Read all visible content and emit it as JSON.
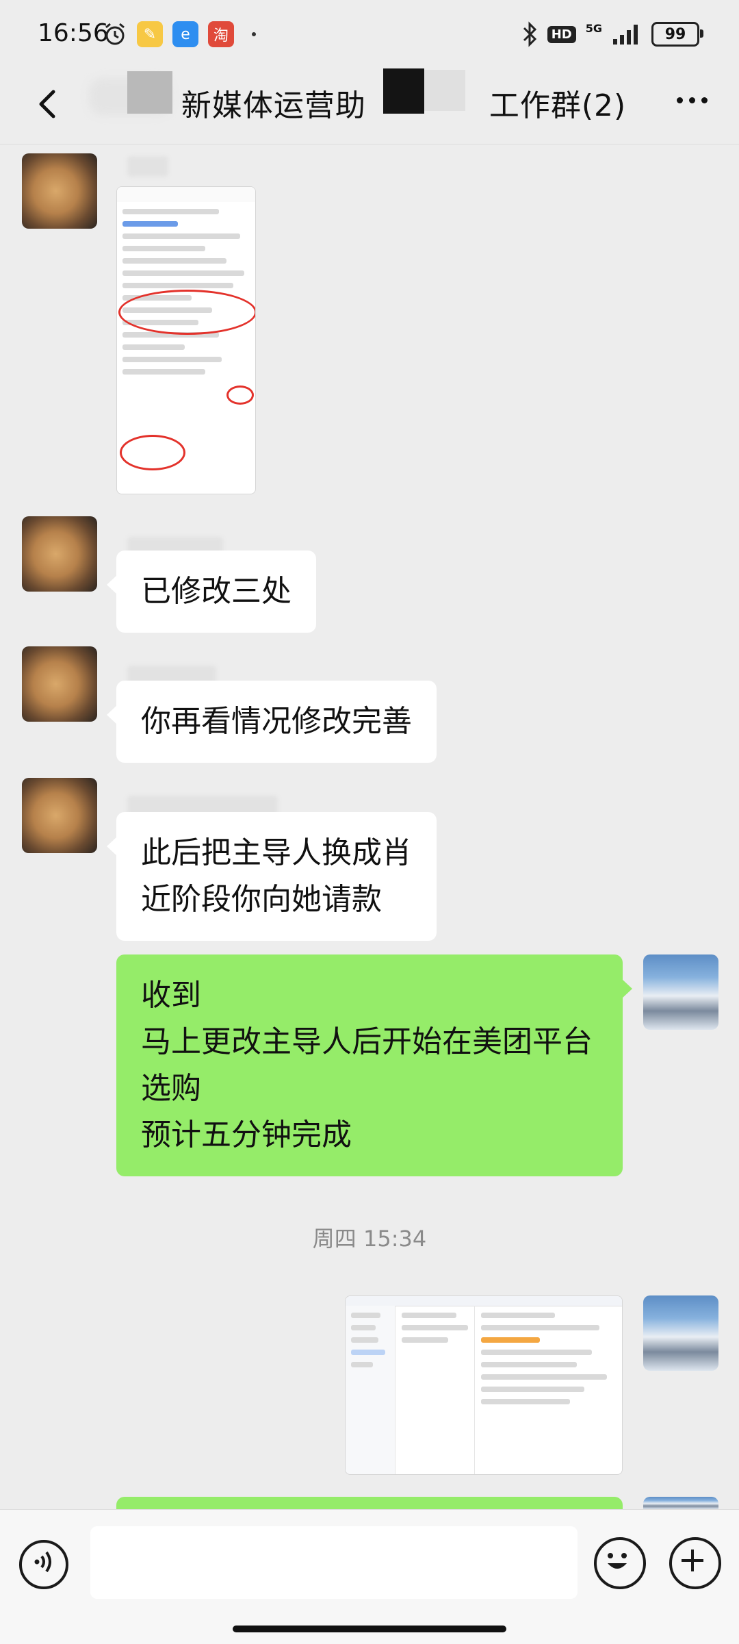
{
  "status_bar": {
    "time": "16:56",
    "network": "5G",
    "hd": "HD",
    "battery": "99"
  },
  "nav": {
    "title_part1": "新媒体运营助",
    "title_part2": "工作群(2)"
  },
  "messages": [
    {
      "side": "left",
      "type": "image",
      "content": "screenshot"
    },
    {
      "side": "left",
      "type": "text",
      "lines": [
        "已修改三处"
      ]
    },
    {
      "side": "left",
      "type": "text",
      "lines": [
        "你再看情况修改完善"
      ]
    },
    {
      "side": "left",
      "type": "text",
      "lines": [
        "此后把主导人换成肖",
        "近阶段你向她请款"
      ]
    },
    {
      "side": "right",
      "type": "text",
      "lines": [
        "收到",
        "马上更改主导人后开始在美团平台",
        "选购",
        "预计五分钟完成"
      ]
    },
    {
      "side": "right",
      "type": "image",
      "content": "screenshot"
    }
  ],
  "timestamp": "周四 15:34",
  "colors": {
    "background": "#ededed",
    "bubble_left": "#ffffff",
    "bubble_right": "#95ec69",
    "annotation_red": "#e3322b"
  },
  "icons": [
    "back-icon",
    "more-icon",
    "voice-icon",
    "emoji-icon",
    "plus-icon",
    "bluetooth-icon",
    "signal-icon",
    "battery-icon",
    "alarm-icon"
  ]
}
